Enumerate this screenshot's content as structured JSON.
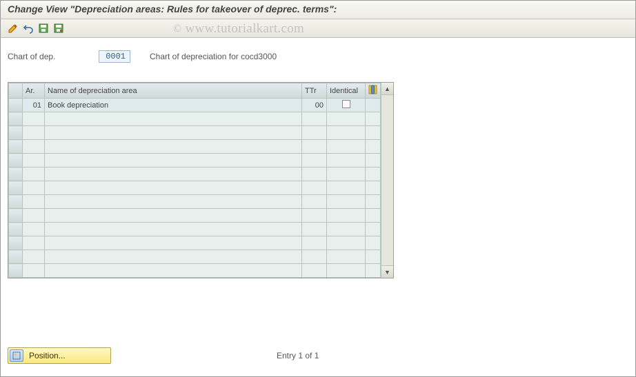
{
  "title": "Change View \"Depreciation areas: Rules for takeover of deprec. terms\":",
  "watermark": "© www.tutorialkart.com",
  "toolbar": {
    "icons": [
      "edit-pencil-icon",
      "undo-icon",
      "save-floppy-icon",
      "save-floppy2-icon"
    ]
  },
  "chart_of_dep": {
    "label": "Chart of dep.",
    "value": "0001",
    "desc": "Chart of depreciation for cocd3000"
  },
  "table": {
    "headers": {
      "select": "",
      "ar": "Ar.",
      "name": "Name of depreciation area",
      "ttr": "TTr",
      "identical": "Identical",
      "config": ""
    },
    "rows": [
      {
        "ar": "01",
        "name": "Book depreciation",
        "ttr": "00",
        "identical": false
      }
    ],
    "blank_rows": 12
  },
  "footer": {
    "position_label": "Position...",
    "entry_status": "Entry 1 of 1"
  }
}
